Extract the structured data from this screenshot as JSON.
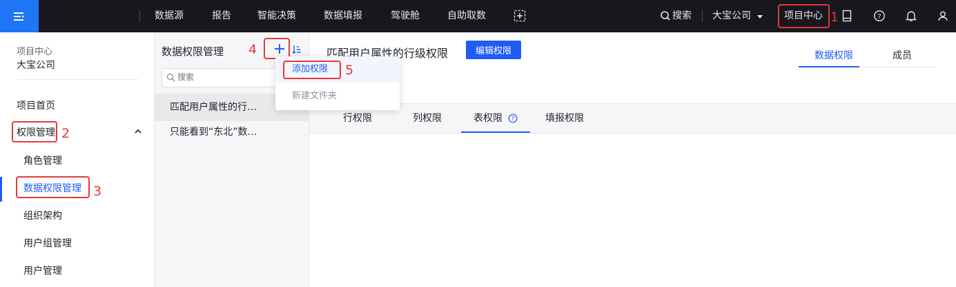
{
  "topnav": {
    "items": [
      "数据源",
      "报告",
      "智能决策",
      "数据填报",
      "驾驶舱",
      "自助取数"
    ],
    "search": "搜索",
    "company": "大宝公司",
    "project_center": "项目中心"
  },
  "sidebar": {
    "context_label": "项目中心",
    "company": "大宝公司",
    "home": "项目首页",
    "section": "权限管理",
    "items": [
      "角色管理",
      "数据权限管理",
      "组织架构",
      "用户组管理",
      "用户管理"
    ]
  },
  "middle": {
    "title": "数据权限管理",
    "search_placeholder": "搜索",
    "list": [
      "匹配用户属性的行…",
      "只能看到“东北”数…"
    ]
  },
  "dropdown": {
    "items": [
      "添加权限",
      "新建文件夹"
    ]
  },
  "main": {
    "title": "匹配用户属性的行级权限",
    "edit_button": "编辑权限",
    "right_tabs": [
      "数据权限",
      "成员"
    ],
    "sub_tabs": [
      "行权限",
      "列权限",
      "表权限",
      "填报权限"
    ]
  },
  "annotations": [
    "1",
    "2",
    "3",
    "4",
    "5"
  ],
  "colors": {
    "accent": "#1f5cf5",
    "annotation": "#e5383b",
    "topbar": "#16181d"
  }
}
